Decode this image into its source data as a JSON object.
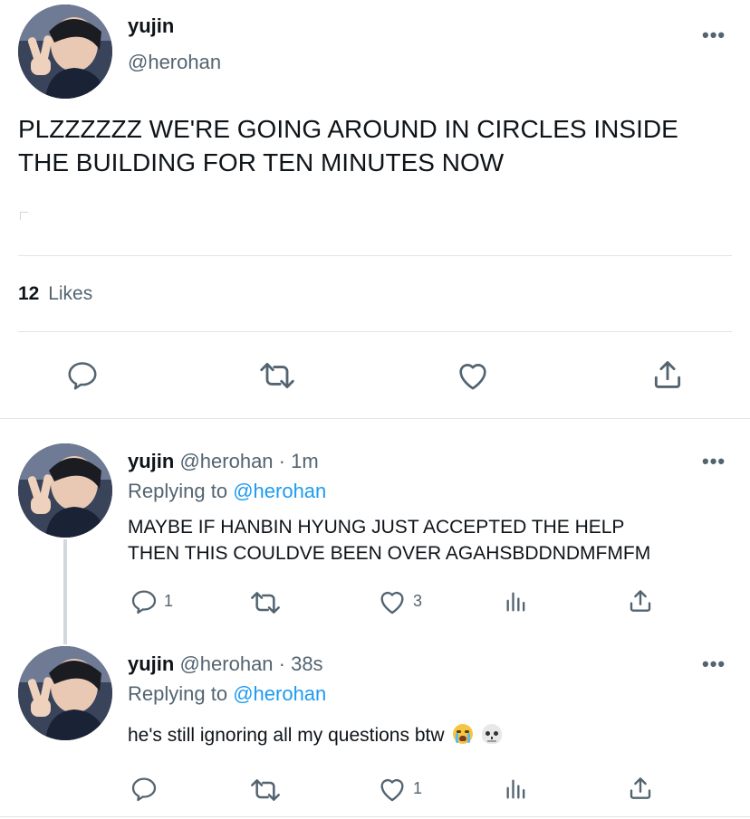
{
  "main_tweet": {
    "author_name": "yujin",
    "author_handle": "@herohan",
    "text_line1": "PLZZZZZZ WE'RE GOING AROUND IN CIRCLES INSIDE",
    "text_line2": "THE BUILDING FOR TEN MINUTES NOW",
    "likes_count": "12",
    "likes_label": "Likes",
    "icons": [
      "reply-icon",
      "retweet-icon",
      "like-icon",
      "share-icon"
    ]
  },
  "replies": [
    {
      "author_name": "yujin",
      "author_meta": "@herohan · 1m",
      "replying_prefix": "Replying to",
      "replying_handle": "@herohan",
      "text_line1": "MAYBE IF HANBIN HYUNG JUST ACCEPTED THE HELP",
      "text_line2": "THEN THIS COULDVE BEEN OVER AGAHSBDDNDMFMFM",
      "reply_count": "1",
      "like_count": "3"
    },
    {
      "author_name": "yujin",
      "author_meta": "@herohan · 38s",
      "replying_prefix": "Replying to",
      "replying_handle": "@herohan",
      "text": "he's still ignoring all my questions btw",
      "emojis": [
        "loudly-crying-face",
        "skull"
      ],
      "reply_count": "",
      "like_count": "1"
    }
  ],
  "colors": {
    "text": "#0f1419",
    "muted": "#536471",
    "link": "#1d9bf0",
    "divider": "#e1e4e8"
  }
}
